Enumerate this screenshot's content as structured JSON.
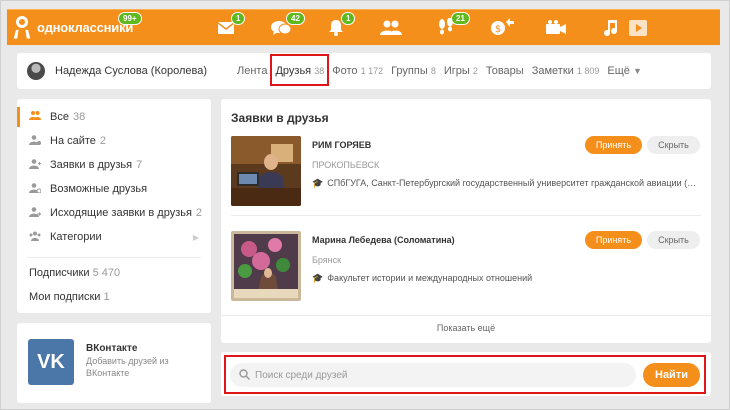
{
  "topbar": {
    "logo_text": "одноклассники",
    "logo_badge": "99+",
    "icons": [
      {
        "icon": "envelope-icon",
        "badge": "1"
      },
      {
        "icon": "chat-icon",
        "badge": "42"
      },
      {
        "icon": "bell-icon",
        "badge": "1"
      },
      {
        "icon": "friends-icon",
        "badge": ""
      },
      {
        "icon": "footprints-icon",
        "badge": "21"
      },
      {
        "icon": "money-icon",
        "badge": ""
      },
      {
        "icon": "camera-icon",
        "badge": ""
      },
      {
        "icon": "music-icon",
        "badge": ""
      },
      {
        "icon": "video-icon",
        "badge": ""
      }
    ]
  },
  "profile": {
    "name": "Надежда Суслова (Королева)"
  },
  "tabs": [
    {
      "label": "Лента",
      "count": ""
    },
    {
      "label": "Друзья",
      "count": "38"
    },
    {
      "label": "Фото",
      "count": "1 172"
    },
    {
      "label": "Группы",
      "count": "8"
    },
    {
      "label": "Игры",
      "count": "2"
    },
    {
      "label": "Товары",
      "count": ""
    },
    {
      "label": "Заметки",
      "count": "1 809"
    },
    {
      "label": "Ещё",
      "count": ""
    }
  ],
  "leftmenu": {
    "items": [
      {
        "label": "Все",
        "count": "38",
        "icon": "people-icon"
      },
      {
        "label": "На сайте",
        "count": "2",
        "icon": "person-online-icon"
      },
      {
        "label": "Заявки в друзья",
        "count": "7",
        "icon": "person-plus-icon"
      },
      {
        "label": "Возможные друзья",
        "count": "",
        "icon": "person-question-icon"
      },
      {
        "label": "Исходящие заявки в друзья",
        "count": "2",
        "icon": "person-arrow-icon"
      },
      {
        "label": "Категории",
        "count": "",
        "icon": "group-icon"
      }
    ],
    "subscribers_label": "Подписчики",
    "subscribers_count": "5 470",
    "subscriptions_label": "Мои подписки",
    "subscriptions_count": "1"
  },
  "vk": {
    "logo": "VK",
    "title": "ВКонтакте",
    "subtitle": "Добавить друзей из ВКонтакте"
  },
  "requests": {
    "title": "Заявки в друзья",
    "accept_label": "Принять",
    "hide_label": "Скрыть",
    "show_more": "Показать ещё",
    "items": [
      {
        "name": "РИМ ГОРЯЕВ",
        "city": "ПРОКОПЬЕВСК",
        "education": "СПбГУГА, Санкт-Петербургский государственный университет гражданской авиации (быв..."
      },
      {
        "name": "Марина Лебедева (Соломатина)",
        "city": "Брянск",
        "education": "Факультет истории и международных отношений"
      }
    ]
  },
  "search": {
    "placeholder": "Поиск среди друзей",
    "value": "",
    "button_label": "Найти"
  }
}
